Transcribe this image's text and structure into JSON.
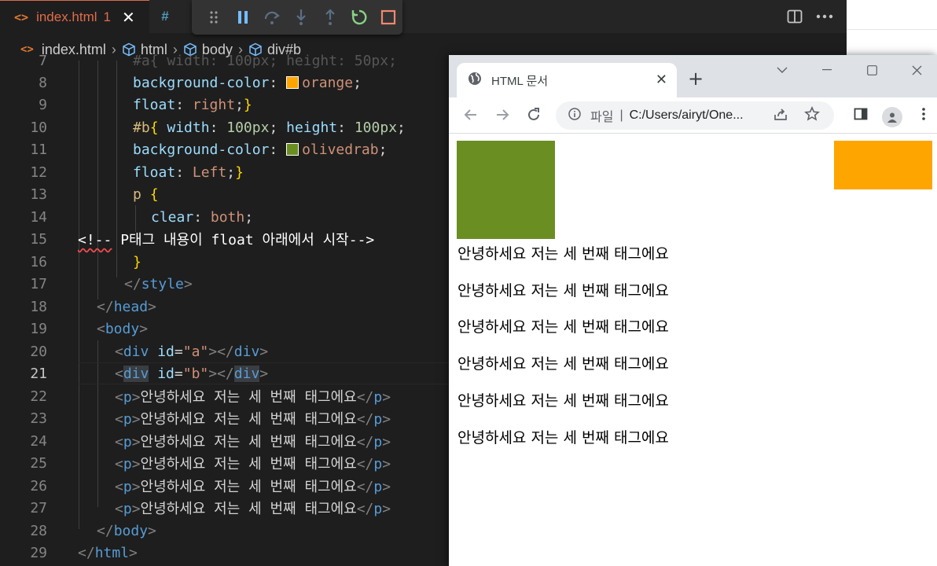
{
  "editor": {
    "active_tab": {
      "icon": "<>",
      "title": "index.html",
      "badge": "1",
      "close": "✕"
    },
    "next_tab_icon": "#",
    "breadcrumb": [
      "index.html",
      "html",
      "body",
      "div#b"
    ],
    "code_lines": [
      {
        "n": "7"
      },
      {
        "n": "8"
      },
      {
        "n": "9"
      },
      {
        "n": "10"
      },
      {
        "n": "11"
      },
      {
        "n": "12"
      },
      {
        "n": "13"
      },
      {
        "n": "14"
      },
      {
        "n": "15"
      },
      {
        "n": "16"
      },
      {
        "n": "17"
      },
      {
        "n": "18"
      },
      {
        "n": "19"
      },
      {
        "n": "20"
      },
      {
        "n": "21"
      },
      {
        "n": "22"
      },
      {
        "n": "23"
      },
      {
        "n": "24"
      },
      {
        "n": "25"
      },
      {
        "n": "26"
      },
      {
        "n": "27"
      },
      {
        "n": "28"
      },
      {
        "n": "29"
      }
    ],
    "code": {
      "l7": "#a{ width: 100px; height: 50px;",
      "l8_prop": "background-color",
      "l8_val": "orange",
      "l9_prop": "float",
      "l9_val": "right",
      "l10_sel": "#b",
      "l10_w": "width",
      "l10_wv": "100px",
      "l10_h": "height",
      "l10_hv": "100px",
      "l11_prop": "background-color",
      "l11_val": "olivedrab",
      "l12_prop": "float",
      "l12_val": "Left",
      "l13_sel": "p",
      "l14_prop": "clear",
      "l14_val": "both",
      "l15_open": "<!--",
      "l15_text": " P태그 내용이 float 아래에서 시작",
      "l15_close": "-->",
      "l17_tag": "style",
      "l18_tag": "head",
      "l19_tag": "body",
      "div_tag": "div",
      "id_attr": "id",
      "a_val": "\"a\"",
      "b_val": "\"b\"",
      "p_tag": "p",
      "p_text": "안녕하세요 저는 세 번째 태그에요",
      "l28_tag": "body",
      "l29_tag": "html"
    },
    "colors": {
      "orange": "#ffa500",
      "olivedrab": "#6b8e23"
    }
  },
  "browser": {
    "tab_title": "HTML 문서",
    "tab_close": "✕",
    "new_tab": "+",
    "omnibox": {
      "site_label": "파일",
      "separator": "|",
      "url": "C:/Users/airyt/One..."
    },
    "paragraphs": [
      "안녕하세요 저는 세 번째 태그에요",
      "안녕하세요 저는 세 번째 태그에요",
      "안녕하세요 저는 세 번째 태그에요",
      "안녕하세요 저는 세 번째 태그에요",
      "안녕하세요 저는 세 번째 태그에요",
      "안녕하세요 저는 세 번째 태그에요"
    ],
    "colors": {
      "box_a": "#ffa500",
      "box_b": "#6b8e23"
    }
  }
}
